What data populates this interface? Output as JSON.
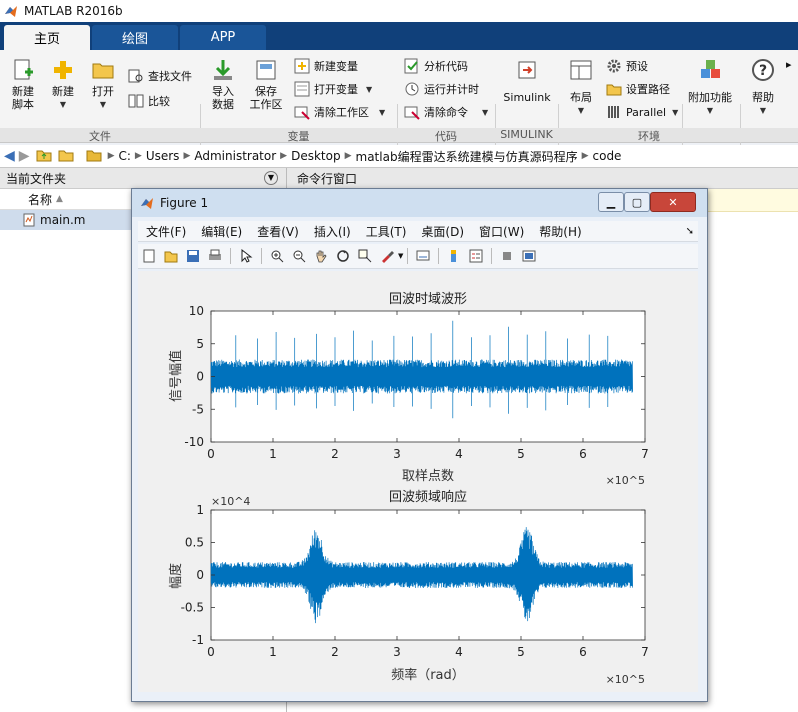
{
  "app": {
    "title": "MATLAB R2016b"
  },
  "tabs": [
    "主页",
    "绘图",
    "APP"
  ],
  "ribbon": {
    "new_script": "新建\n脚本",
    "new": "新建",
    "open": "打开",
    "find_files": "查找文件",
    "compare": "比较",
    "import": "导入\n数据",
    "save_ws": "保存\n工作区",
    "new_var": "新建变量",
    "open_var": "打开变量",
    "clear_ws": "清除工作区",
    "analyze": "分析代码",
    "run_time": "运行并计时",
    "clear_cmd": "清除命令",
    "simulink": "Simulink",
    "layout": "布局",
    "prefs": "预设",
    "set_path": "设置路径",
    "parallel": "Parallel",
    "addons": "附加功能",
    "help": "帮助",
    "sections": [
      "文件",
      "变量",
      "代码",
      "SIMULINK",
      "环境"
    ]
  },
  "address": [
    "C:",
    "Users",
    "Administrator",
    "Desktop",
    "matlab编程雷达系统建模与仿真源码程序",
    "code"
  ],
  "left_panel": {
    "title": "当前文件夹",
    "col_name": "名称",
    "file": "main.m"
  },
  "right_panel": {
    "title": "命令行窗口"
  },
  "figure": {
    "title": "Figure 1",
    "menus": [
      "文件(F)",
      "编辑(E)",
      "查看(V)",
      "插入(I)",
      "工具(T)",
      "桌面(D)",
      "窗口(W)",
      "帮助(H)"
    ]
  },
  "chart_data": [
    {
      "type": "line",
      "title": "回波时域波形",
      "xlabel": "取样点数",
      "ylabel": "信号幅值",
      "xlim": [
        0,
        7
      ],
      "ylim": [
        -10,
        10
      ],
      "x_multiplier": "×10^5",
      "xticks": [
        "0",
        "1",
        "2",
        "3",
        "4",
        "5",
        "6",
        "7"
      ],
      "yticks": [
        "10",
        "5",
        "0",
        "-5",
        "-10"
      ],
      "data_extent": [
        0,
        6.8
      ],
      "noise_amplitude": 2.6,
      "spike_positions": [
        0.4,
        0.75,
        1.05,
        1.35,
        1.7,
        2.0,
        2.3,
        2.6,
        2.95,
        3.25,
        3.55,
        3.9,
        4.2,
        4.5,
        4.8,
        5.1,
        5.4,
        5.75,
        6.1,
        6.4
      ],
      "spike_amplitudes": [
        6.3,
        5.8,
        6.8,
        5.9,
        6.5,
        6.0,
        7.0,
        5.5,
        6.2,
        6.1,
        6.6,
        8.5,
        6.0,
        6.3,
        7.6,
        6.4,
        6.9,
        5.8,
        6.4,
        6.2
      ],
      "color": "#0072bd"
    },
    {
      "type": "line",
      "title": "回波频域响应",
      "xlabel": "频率（rad）",
      "ylabel": "幅度",
      "xlim": [
        0,
        7
      ],
      "ylim": [
        -1,
        1
      ],
      "x_multiplier": "×10^5",
      "y_multiplier": "×10^4",
      "xticks": [
        "0",
        "1",
        "2",
        "3",
        "4",
        "5",
        "6",
        "7"
      ],
      "yticks": [
        "1",
        "0.5",
        "0",
        "-0.5",
        "-1"
      ],
      "data_extent": [
        0,
        6.8
      ],
      "noise_amplitude": 0.2,
      "lobe_centers": [
        1.7,
        5.1
      ],
      "lobe_peak": 0.75,
      "color": "#0072bd"
    }
  ]
}
